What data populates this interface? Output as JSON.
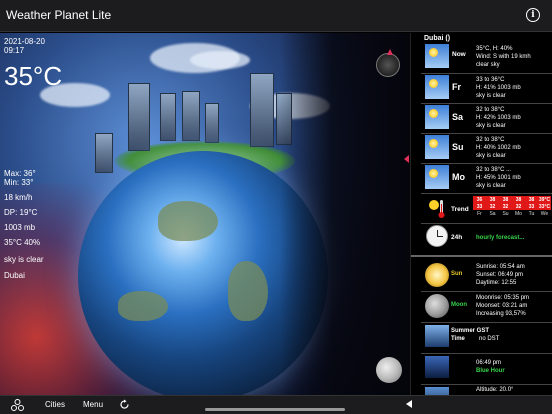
{
  "app": {
    "title": "Weather Planet Lite",
    "info_icon": "info-icon"
  },
  "current": {
    "date": "2021-08-20",
    "time": "09:17",
    "temperature": "35°C",
    "max": "Max: 36°",
    "min": "Min: 33°",
    "wind": "18 km/h",
    "dew_point": "DP: 19°C",
    "pressure": "1003 mb",
    "temp_humidity": "35°C 40%",
    "condition": "sky is clear",
    "city": "Dubai"
  },
  "panel": {
    "location": "Dubai ()",
    "forecast": [
      {
        "day": "Now",
        "line1": "35°C, H: 40%",
        "line2": "Wind: S with 19 kmh",
        "line3": "clear sky"
      },
      {
        "day": "Fr",
        "line1": "33 to 36°C",
        "line2": "H: 41% 1003 mb",
        "line3": "sky is clear"
      },
      {
        "day": "Sa",
        "line1": "32 to 38°C",
        "line2": "H: 42% 1003 mb",
        "line3": "sky is clear"
      },
      {
        "day": "Su",
        "line1": "32 to 38°C",
        "line2": "H: 40% 1002 mb",
        "line3": "sky is clear"
      },
      {
        "day": "Mo",
        "line1": "32 to 38°C ...",
        "line2": "H: 45% 1001 mb",
        "line3": "sky is clear"
      }
    ],
    "trend": {
      "label": "Trend",
      "highs": [
        "36",
        "38",
        "38",
        "38",
        "38",
        "39°C"
      ],
      "lows": [
        "33",
        "32",
        "32",
        "32",
        "33",
        "33°C"
      ],
      "days": [
        "Fr",
        "Sa",
        "Su",
        "Mo",
        "Tu",
        "We"
      ]
    },
    "hourly": {
      "label": "24h",
      "link": "hourly forecast..."
    },
    "sun": {
      "label": "Sun",
      "line1": "Sunrise: 05:54 am",
      "line2": "Sunset: 06:49 pm",
      "line3": "Daytime: 12:55"
    },
    "moon": {
      "label": "Moon",
      "line1": "Moonrise: 05:35 pm",
      "line2": "Moonset: 03:21 am",
      "line3": "Increasing 93,57%"
    },
    "time_zone": {
      "label1": "Summer GST",
      "label2": "Time",
      "value": "no DST"
    },
    "blue_hour": {
      "time": "06:49 pm",
      "label": "Blue Hour"
    },
    "altitude": {
      "text": "Altitude: 20.0°"
    }
  },
  "bottombar": {
    "cities": "Cities",
    "menu": "Menu"
  },
  "colors": {
    "accent_red": "#e01818",
    "green": "#39d24a",
    "yellow": "#e9c92a"
  }
}
